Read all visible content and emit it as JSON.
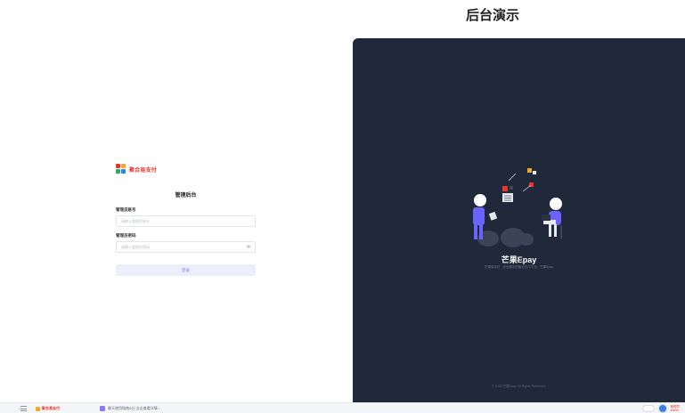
{
  "page": {
    "title": "后台演示"
  },
  "login": {
    "brand_name": "聚合易支付",
    "title": "管理后台",
    "account_label": "管理员账号",
    "account_placeholder": "请输入管理员账号",
    "password_label": "管理员密码",
    "password_placeholder": "请输入管理员密码",
    "submit_label": "登录"
  },
  "promo": {
    "brand": "芒果Epay",
    "subtitle": "芒果易支付 · 安全稳定的聚合支付平台 · 芒果Epay",
    "copyright": "© 2023 芒果Epay. All Rights Reserved."
  },
  "taskbar": {
    "brand": "聚合易支付",
    "tab_label": "聊天使用指南&分  点击查看详情 ›",
    "user_name": "管理员",
    "user_role": "admin"
  },
  "colors": {
    "accent_red": "#e8342c",
    "panel_dark": "#1f2939",
    "button_bg": "#eceefc",
    "button_text": "#7c86e6"
  }
}
